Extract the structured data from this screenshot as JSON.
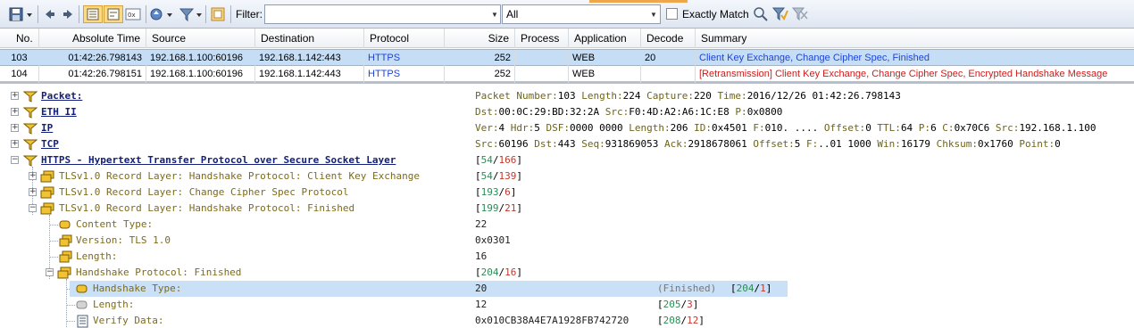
{
  "toolbar": {
    "filter_label": "Filter:",
    "filter_value": "",
    "scope_value": "All",
    "exact_match_label": "Exactly Match"
  },
  "packet_list": {
    "columns": [
      "No.",
      "Absolute Time",
      "Source",
      "Destination",
      "Protocol",
      "Size",
      "Process",
      "Application",
      "Decode",
      "Summary"
    ],
    "rows": [
      {
        "no": "103",
        "time": "01:42:26.798143",
        "source": "192.168.1.100:60196",
        "destination": "192.168.1.142:443",
        "protocol": "HTTPS",
        "size": "252",
        "process": "",
        "application": "WEB",
        "decode": "20",
        "summary": "Client Key Exchange, Change Cipher Spec, Finished"
      },
      {
        "no": "104",
        "time": "01:42:26.798151",
        "source": "192.168.1.100:60196",
        "destination": "192.168.1.142:443",
        "protocol": "HTTPS",
        "size": "252",
        "process": "",
        "application": "WEB",
        "decode": "",
        "summary": "[Retransmission] Client Key Exchange, Change Cipher Spec, Encrypted Handshake Message"
      }
    ]
  },
  "tree": {
    "packet": {
      "label": "Packet:",
      "k1": "Packet Number:",
      "v1": "103",
      "k2": " Length:",
      "v2": "224",
      "k3": " Capture:",
      "v3": "220",
      "k4": " Time:",
      "v4": "2016/12/26 01:42:26.798143"
    },
    "eth": {
      "label": "ETH II",
      "k1": "Dst:",
      "v1": "00:0C:29:BD:32:2A",
      "k2": " Src:",
      "v2": "F0:4D:A2:A6:1C:E8",
      "k3": " P:",
      "v3": "0x0800"
    },
    "ip": {
      "label": "IP",
      "k1": "Ver:",
      "v1": "4",
      "k2": " Hdr:",
      "v2": "5",
      "k3": " DSF:",
      "v3": "0000 0000",
      "k4": " Length:",
      "v4": "206",
      "k5": " ID:",
      "v5": "0x4501",
      "k6": " F:",
      "v6": "010. ....",
      "k7": " Offset:",
      "v7": "0",
      "k8": " TTL:",
      "v8": "64",
      "k9": " P:",
      "v9": "6",
      "k10": " C:",
      "v10": "0x70C6",
      "k11": " Src:",
      "v11": "192.168.1.100"
    },
    "tcp": {
      "label": "TCP",
      "k1": "Src:",
      "v1": "60196",
      "k2": " Dst:",
      "v2": "443",
      "k3": " Seq:",
      "v3": "931869053",
      "k4": " Ack:",
      "v4": "2918678061",
      "k5": " Offset:",
      "v5": "5",
      "k6": " F:",
      "v6": "..01 1000",
      "k7": " Win:",
      "v7": "16179",
      "k8": " Chksum:",
      "v8": "0x1760",
      "k9": " Point:",
      "v9": "0"
    },
    "https": {
      "label": "HTTPS - Hypertext Transfer Protocol over Secure Socket Layer",
      "r1": "54",
      "r2": "166"
    },
    "rec1": {
      "label": "TLSv1.0 Record Layer: Handshake Protocol: Client Key Exchange",
      "r1": "54",
      "r2": "139"
    },
    "rec2": {
      "label": "TLSv1.0 Record Layer: Change Cipher Spec Protocol",
      "r1": "193",
      "r2": "6"
    },
    "rec3": {
      "label": "TLSv1.0 Record Layer: Handshake Protocol: Finished",
      "r1": "199",
      "r2": "21"
    },
    "content_type": {
      "label": "Content Type:",
      "value": "22"
    },
    "version": {
      "label": "Version: TLS 1.0",
      "value": "0x0301"
    },
    "length": {
      "label": "Length:",
      "value": "16"
    },
    "hs_protocol": {
      "label": "Handshake Protocol: Finished",
      "r1": "204",
      "r2": "16"
    },
    "hs_type": {
      "label": "Handshake Type:",
      "value": "20",
      "note": "(Finished)",
      "r1": "204",
      "r2": "1"
    },
    "hs_length": {
      "label": "Length:",
      "value": "12",
      "r1": "205",
      "r2": "3"
    },
    "verify": {
      "label": "Verify Data:",
      "value": "0x010CB38A4E7A1928FB742720",
      "r1": "208",
      "r2": "12"
    }
  }
}
